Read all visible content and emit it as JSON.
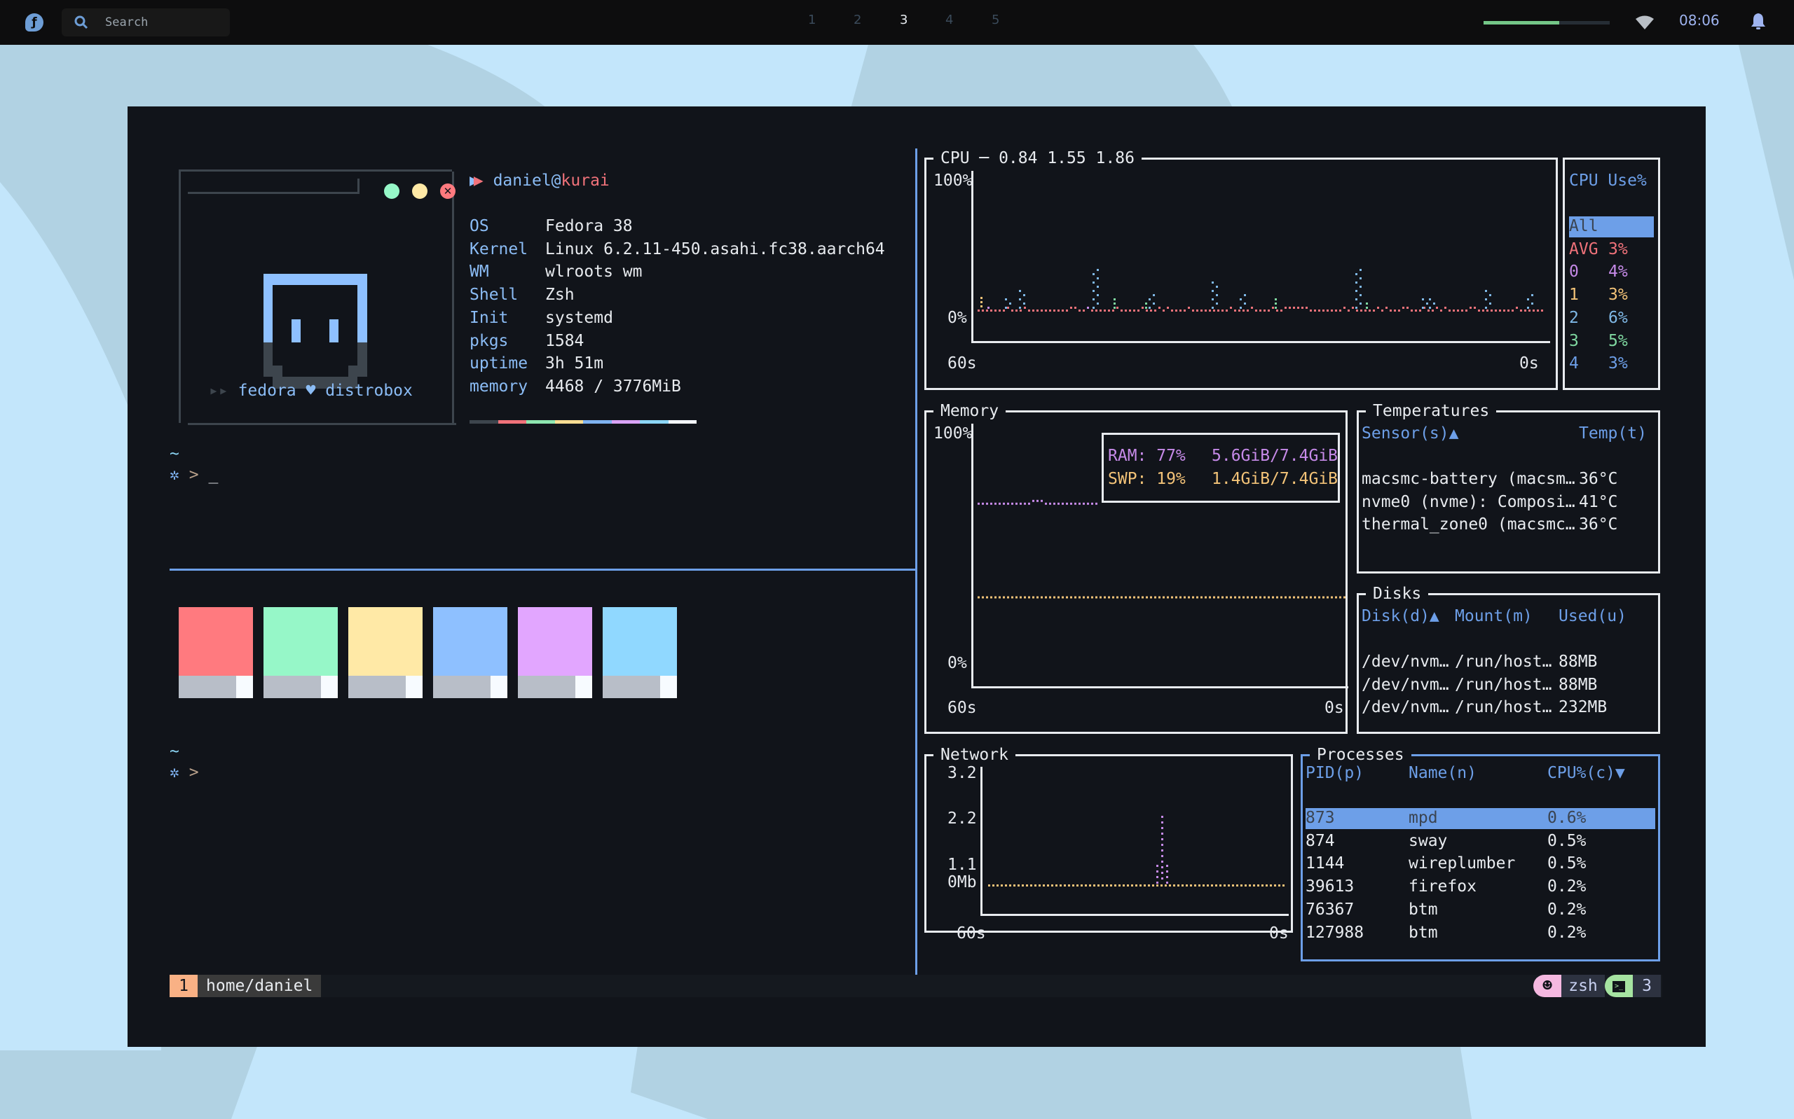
{
  "topbar": {
    "search_placeholder": "Search",
    "workspaces": [
      "1",
      "2",
      "3",
      "4",
      "5"
    ],
    "active_workspace": "3",
    "volume_level_percent": 60,
    "clock": "08:06"
  },
  "fetch": {
    "user": "daniel",
    "at": "@",
    "host": "kurai",
    "fields": [
      {
        "key": "OS",
        "value": "Fedora 38"
      },
      {
        "key": "Kernel",
        "value": "Linux 6.2.11-450.asahi.fc38.aarch64"
      },
      {
        "key": "WM",
        "value": "wlroots wm"
      },
      {
        "key": "Shell",
        "value": "Zsh"
      },
      {
        "key": "Init",
        "value": "systemd"
      },
      {
        "key": "pkgs",
        "value": "1584"
      },
      {
        "key": "uptime",
        "value": "3h 51m"
      },
      {
        "key": "memory",
        "value": "4468 / 3776MiB"
      }
    ],
    "tagline_left": "fedora",
    "tagline_right": "distrobox",
    "color_strip": [
      "#3d454d",
      "#f0727a",
      "#8ee6b0",
      "#f9dd92",
      "#7fb2f0",
      "#d9a3f5",
      "#8cd6f5",
      "#f4f7fb"
    ]
  },
  "prompt": {
    "cwd": "~",
    "arrow": ">",
    "cursor": "_"
  },
  "palette": [
    "#ff7a7f",
    "#96f7c8",
    "#ffe9a6",
    "#8ec0ff",
    "#e2a6ff",
    "#90d8ff"
  ],
  "btm": {
    "cpu": {
      "title": "CPU ─ 0.84 1.55 1.86",
      "y_top": "100%",
      "y_bottom": "0%",
      "x_left": "60s",
      "x_right": "0s",
      "legend_title": "CPU Use%",
      "legend": [
        {
          "name": "All",
          "value": "",
          "color": "#3a4452",
          "selected": true
        },
        {
          "name": "AVG",
          "value": "3%",
          "color": "#f0727a"
        },
        {
          "name": "0",
          "value": "4%",
          "color": "#c68ae8"
        },
        {
          "name": "1",
          "value": "3%",
          "color": "#f3c378"
        },
        {
          "name": "2",
          "value": "6%",
          "color": "#7fb8e6"
        },
        {
          "name": "3",
          "value": "5%",
          "color": "#7fd8a0"
        },
        {
          "name": "4",
          "value": "3%",
          "color": "#6d9fe8"
        }
      ]
    },
    "memory": {
      "title": "Memory",
      "y_top": "100%",
      "y_bottom": "0%",
      "x_left": "60s",
      "x_right": "0s",
      "ram_label": "RAM: 77%",
      "ram_value": "5.6GiB/7.4GiB",
      "swp_label": "SWP: 19%",
      "swp_value": "1.4GiB/7.4GiB",
      "ram_percent": 77,
      "swp_percent": 19
    },
    "temperatures": {
      "title": "Temperatures",
      "headers": [
        "Sensor(s)▲",
        "Temp(t)"
      ],
      "rows": [
        [
          "macsmc-battery (macsm…",
          "36°C"
        ],
        [
          "nvme0 (nvme): Composi…",
          "41°C"
        ],
        [
          "thermal_zone0 (macsmc…",
          "36°C"
        ]
      ]
    },
    "disks": {
      "title": "Disks",
      "headers": [
        "Disk(d)▲",
        "Mount(m)",
        "Used(u)"
      ],
      "rows": [
        [
          "/dev/nvm…",
          "/run/host…",
          "88MB"
        ],
        [
          "/dev/nvm…",
          "/run/host…",
          "88MB"
        ],
        [
          "/dev/nvm…",
          "/run/host…",
          "232MB"
        ]
      ]
    },
    "network": {
      "title": "Network",
      "y_ticks": [
        "3.2",
        "2.2",
        "1.1",
        "0Mb"
      ],
      "x_left": "60s",
      "x_right": "0s"
    },
    "processes": {
      "title": "Processes",
      "headers": [
        "PID(p)",
        "Name(n)",
        "CPU%(c)▼"
      ],
      "rows": [
        [
          "873",
          "mpd",
          "0.6%"
        ],
        [
          "874",
          "sway",
          "0.5%"
        ],
        [
          "1144",
          "wireplumber",
          "0.5%"
        ],
        [
          "39613",
          "firefox",
          "0.2%"
        ],
        [
          "76367",
          "btm",
          "0.2%"
        ],
        [
          "127988",
          "btm",
          "0.2%"
        ]
      ],
      "selected_index": 0
    }
  },
  "statusbar": {
    "window_index": "1",
    "path": "home/daniel",
    "shell": "zsh",
    "pane_count": "3"
  }
}
